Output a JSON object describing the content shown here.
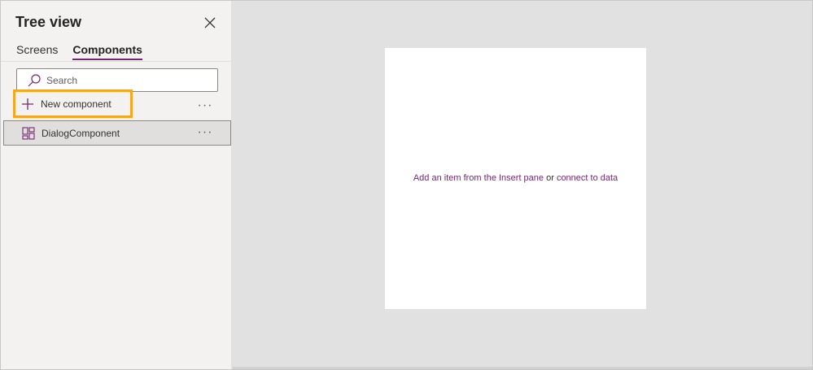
{
  "panel": {
    "title": "Tree view",
    "tabs": [
      {
        "label": "Screens",
        "active": false
      },
      {
        "label": "Components",
        "active": true
      }
    ]
  },
  "search": {
    "placeholder": "Search",
    "value": ""
  },
  "new_component": {
    "label": "New component",
    "highlight_color": "#f5a623"
  },
  "components": [
    {
      "label": "DialogComponent",
      "selected": true
    }
  ],
  "more_label": "···",
  "canvas": {
    "hint_prefix": "Add an item from the Insert pane",
    "hint_or": "or",
    "hint_link": "connect to data"
  },
  "colors": {
    "accent": "#742774",
    "highlight": "#f5a623"
  }
}
